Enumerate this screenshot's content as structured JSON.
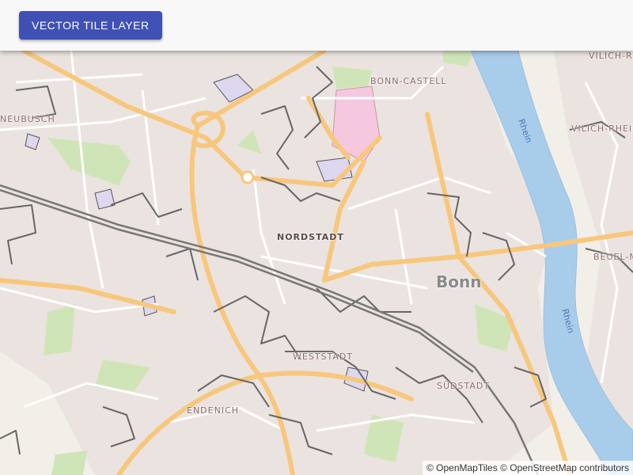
{
  "toolbar": {
    "button_label": "VECTOR TILE LAYER"
  },
  "colors": {
    "land": "#f2efe9",
    "river": "#a8cdeb",
    "major_road": "#f7c77d",
    "minor_road": "#ffffff",
    "boundary": "#666666",
    "rail": "#777777",
    "park": "#c8e0b0",
    "pink_area": "#f5c8e0",
    "building": "#e9d8d3"
  },
  "places": [
    {
      "name": "BONN-CASTELL",
      "kind": "district"
    },
    {
      "name": "VILICH-RHEINDORF",
      "kind": "district"
    },
    {
      "name": "VILICH-RHEINDORF",
      "kind": "district"
    },
    {
      "name": "NEUBUSCH",
      "kind": "district"
    },
    {
      "name": "NORDSTADT",
      "kind": "district"
    },
    {
      "name": "Bonn",
      "kind": "city"
    },
    {
      "name": "BEUEL-MI",
      "kind": "district"
    },
    {
      "name": "WESTSTADT",
      "kind": "district"
    },
    {
      "name": "SÜDSTADT",
      "kind": "district"
    },
    {
      "name": "ENDENICH",
      "kind": "district"
    }
  ],
  "river": {
    "name": "Rhein"
  },
  "attribution": "© OpenMapTiles © OpenStreetMap contributors"
}
